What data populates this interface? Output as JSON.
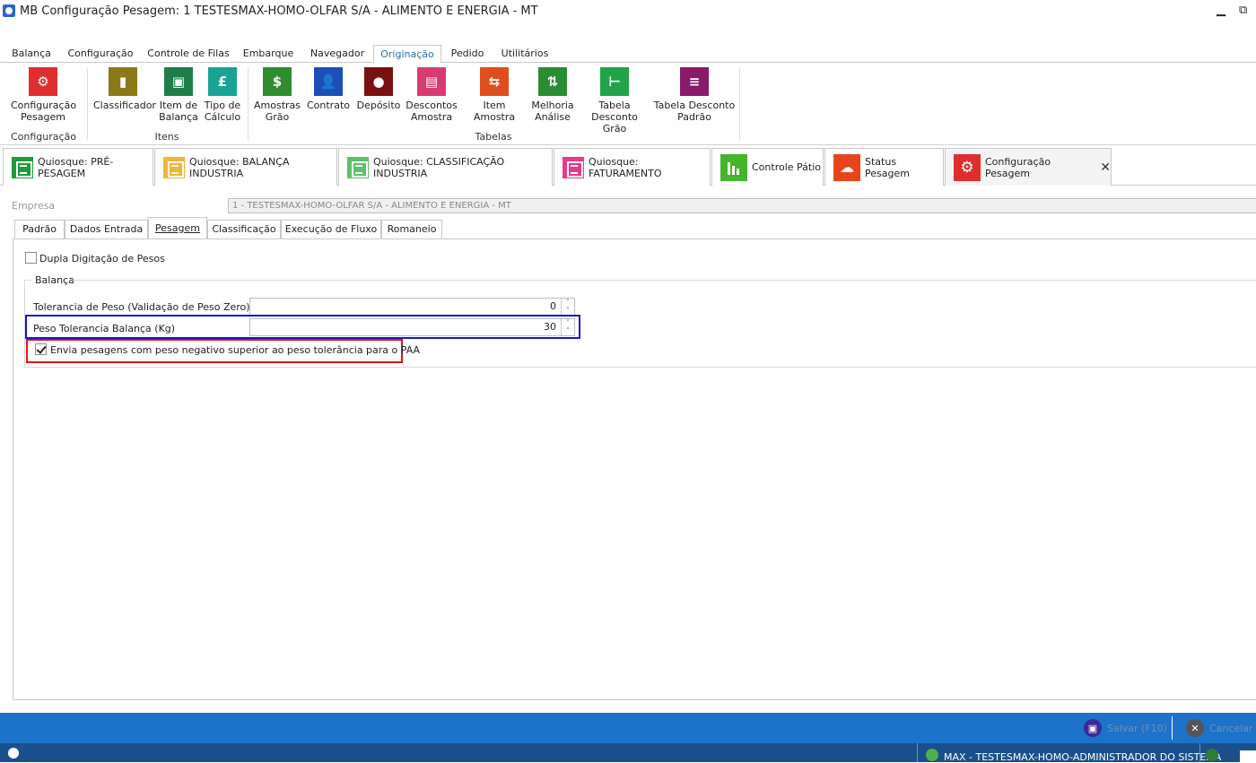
{
  "window": {
    "title": "MB Configuração Pesagem: 1 TESTESMAX-HOMO-OLFAR S/A - ALIMENTO E ENERGIA - MT"
  },
  "menu_tabs": [
    "Balança",
    "Configuração",
    "Controle de Filas",
    "Embarque",
    "Navegador",
    "Originação",
    "Pedido",
    "Utilitários"
  ],
  "active_menu_tab": "Originação",
  "ribbon": {
    "buttons": [
      {
        "label": "Configuração\nPesagem",
        "icon": "gear-icon",
        "color": "#e02e2e"
      },
      {
        "label": "Classificador",
        "icon": "bookmark-icon",
        "color": "#8a7a17"
      },
      {
        "label": "Item de\nBalança",
        "icon": "box-icon",
        "color": "#1f7d4a"
      },
      {
        "label": "Tipo de\nCálculo",
        "icon": "pound-icon",
        "color": "#18a394"
      },
      {
        "label": "Amostras\nGrão",
        "icon": "money-plant-icon",
        "color": "#2f8c2f"
      },
      {
        "label": "Contrato",
        "icon": "user-doc-icon",
        "color": "#1d4fb8"
      },
      {
        "label": "Depósito",
        "icon": "location-icon",
        "color": "#7a1010"
      },
      {
        "label": "Descontos\nAmostra",
        "icon": "box-minus-icon",
        "color": "#d63c70"
      },
      {
        "label": "Item Amostra",
        "icon": "arrows-icon",
        "color": "#e04e1d"
      },
      {
        "label": "Melhoria\nAnálise",
        "icon": "up-arrows-icon",
        "color": "#2a8c33"
      },
      {
        "label": "Tabela\nDesconto Grão",
        "icon": "table-arrow-icon",
        "color": "#22a34a"
      },
      {
        "label": "Tabela Desconto\nPadrão",
        "icon": "list-icon",
        "color": "#8a1a6a"
      }
    ],
    "groups": [
      "Configuração",
      "Itens",
      "Tabelas"
    ]
  },
  "doc_tabs": [
    {
      "label": "Quiosque: PRÉ-PESAGEM",
      "color": "#1f9a3c"
    },
    {
      "label": "Quiosque: BALANÇA INDUSTRIA",
      "color": "#f0b535"
    },
    {
      "label": "Quiosque: CLASSIFICAÇÃO INDUSTRIA",
      "color": "#5cc06a"
    },
    {
      "label": "Quiosque: FATURAMENTO",
      "color": "#e63a8a"
    },
    {
      "label": "Controle Pátio",
      "color": "#44b52c"
    },
    {
      "label": "Status Pesagem",
      "color": "#e8441c"
    },
    {
      "label": "Configuração Pesagem",
      "color": "#e02e2e"
    }
  ],
  "form": {
    "empresa_label": "Empresa",
    "empresa_value": "1 - TESTESMAX-HOMO-OLFAR S/A - ALIMENTO E ENERGIA - MT",
    "sub_tabs": [
      "Padrão",
      "Dados Entrada",
      "Pesagem",
      "Classificação",
      "Execução de Fluxo",
      "Romaneio"
    ],
    "active_sub_tab": "Pesagem",
    "dupla_label": "Dupla Digitação de Pesos",
    "dupla_checked": false,
    "group_title": "Balança",
    "tol_zero_label": "Tolerancia de Peso (Validação de Peso Zero) (Kg)",
    "tol_zero_value": "0",
    "tol_balanca_label": "Peso Tolerancia Balança (Kg)",
    "tol_balanca_value": "30",
    "envia_label": "Envia pesagens com peso negativo superior ao peso tolerância para o PAA",
    "envia_checked": true
  },
  "actions": {
    "save": "Salvar (F10)",
    "cancel": "Cancelar"
  },
  "footer": {
    "user": "MAX - TESTESMAX-HOMO-ADMINISTRADOR DO SISTEMA"
  },
  "colors": {
    "statusbar": "#1c73c9",
    "highlight_blue": "#1515c8",
    "highlight_red": "#e01515",
    "active_tab_text": "#2b6cb3"
  }
}
